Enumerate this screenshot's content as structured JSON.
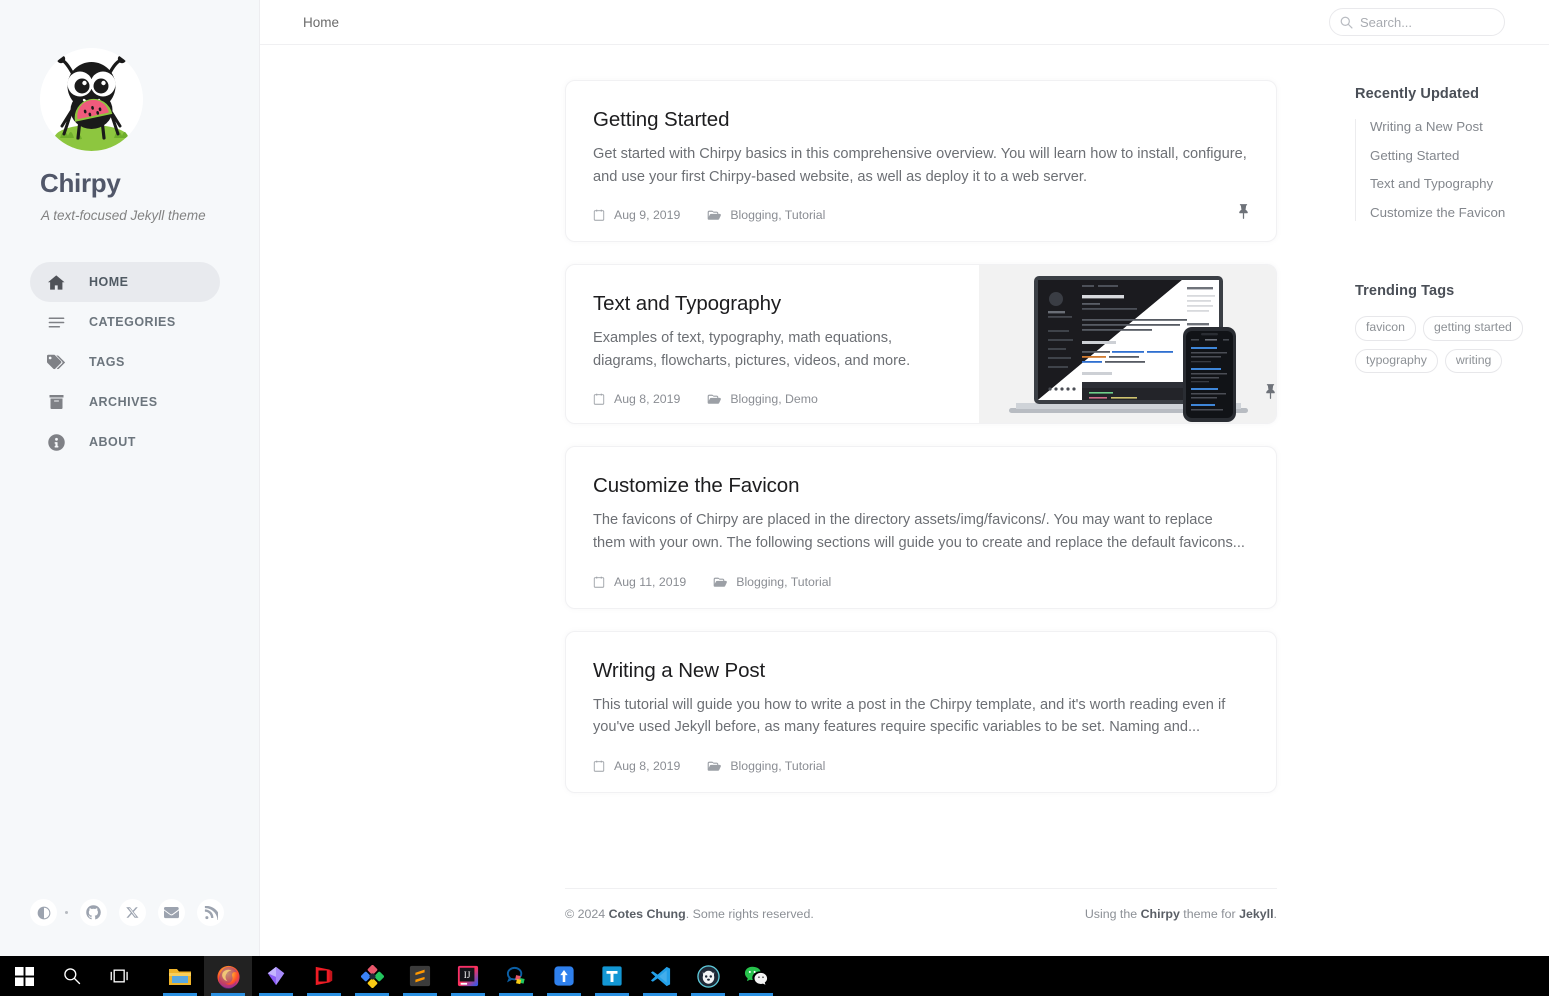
{
  "sidebar": {
    "avatar_icon": "chirpy-ant-avatar",
    "title": "Chirpy",
    "subtitle": "A text-focused Jekyll theme",
    "nav_items": [
      {
        "label": "HOME",
        "icon": "home-icon",
        "active": true
      },
      {
        "label": "CATEGORIES",
        "icon": "stream-list-icon",
        "active": false
      },
      {
        "label": "TAGS",
        "icon": "tags-icon",
        "active": false
      },
      {
        "label": "ARCHIVES",
        "icon": "archive-box-icon",
        "active": false
      },
      {
        "label": "ABOUT",
        "icon": "info-circle-icon",
        "active": false
      }
    ],
    "contact_icons": [
      "theme-toggle-icon",
      "github-icon",
      "x-twitter-icon",
      "email-icon",
      "rss-icon"
    ]
  },
  "topbar": {
    "breadcrumb": "Home",
    "search_placeholder": "Search...",
    "search_value": "",
    "search_icon": "search-icon"
  },
  "posts": [
    {
      "title": "Getting Started",
      "excerpt": "Get started with Chirpy basics in this comprehensive overview. You will learn how to install, configure, and use your first Chirpy-based website, as well as deploy it to a web server.",
      "date": "Aug 9, 2019",
      "categories": "Blogging, Tutorial",
      "pinned": true,
      "has_thumbnail": false
    },
    {
      "title": "Text and Typography",
      "excerpt": "Examples of text, typography, math equations, diagrams, flowcharts, pictures, videos, and more.",
      "date": "Aug 8, 2019",
      "categories": "Blogging, Demo",
      "pinned": true,
      "has_thumbnail": true,
      "thumbnail_alt": "laptop-and-phone-chirpy-theme-mockup"
    },
    {
      "title": "Customize the Favicon",
      "excerpt": "The favicons of Chirpy are placed in the directory assets/img/favicons/. You may want to replace them with your own. The following sections will guide you to create and replace the default favicons...",
      "date": "Aug 11, 2019",
      "categories": "Blogging, Tutorial",
      "pinned": false,
      "has_thumbnail": false
    },
    {
      "title": "Writing a New Post",
      "excerpt": "This tutorial will guide you how to write a post in the Chirpy template, and it's worth reading even if you've used Jekyll before, as many features require specific variables to be set. Naming and...",
      "date": "Aug 8, 2019",
      "categories": "Blogging, Tutorial",
      "pinned": false,
      "has_thumbnail": false
    }
  ],
  "right_panel": {
    "recently_updated": {
      "heading": "Recently Updated",
      "items": [
        "Writing a New Post",
        "Getting Started",
        "Text and Typography",
        "Customize the Favicon"
      ]
    },
    "trending_tags": {
      "heading": "Trending Tags",
      "tags": [
        "favicon",
        "getting started",
        "typography",
        "writing"
      ]
    }
  },
  "footer": {
    "copyright_prefix": "© 2024 ",
    "copyright_author": "Cotes Chung",
    "copyright_suffix": ". Some rights reserved.",
    "theme_prefix": "Using the ",
    "theme_name": "Chirpy",
    "theme_middle": " theme for ",
    "theme_platform": "Jekyll",
    "theme_suffix": "."
  },
  "taskbar": {
    "items": [
      {
        "name": "start-button",
        "icon": "windows-logo-icon",
        "running": false,
        "active": false
      },
      {
        "name": "search-button",
        "icon": "magnifier-icon",
        "running": false,
        "active": false
      },
      {
        "name": "task-view-button",
        "icon": "task-view-icon",
        "running": false,
        "active": false
      },
      {
        "name": "file-explorer",
        "icon": "folder-icon",
        "running": true,
        "active": false
      },
      {
        "name": "firefox",
        "icon": "firefox-icon",
        "running": true,
        "active": true
      },
      {
        "name": "gem-app",
        "icon": "purple-gem-icon",
        "running": true,
        "active": false
      },
      {
        "name": "red-app",
        "icon": "red-cube-icon",
        "running": true,
        "active": false
      },
      {
        "name": "diamond-app",
        "icon": "color-diamond-icon",
        "running": true,
        "active": false
      },
      {
        "name": "sublime-text",
        "icon": "sublime-text-icon",
        "running": true,
        "active": false
      },
      {
        "name": "intellij-idea",
        "icon": "intellij-idea-icon",
        "running": true,
        "active": false
      },
      {
        "name": "qq-chat",
        "icon": "qq-chat-icon",
        "running": true,
        "active": false
      },
      {
        "name": "blue-arrow-app",
        "icon": "blue-arrow-icon",
        "running": true,
        "active": false
      },
      {
        "name": "typora",
        "icon": "typora-t-icon",
        "running": true,
        "active": false
      },
      {
        "name": "vs-code",
        "icon": "vscode-icon",
        "running": true,
        "active": false
      },
      {
        "name": "husky-app",
        "icon": "husky-circle-icon",
        "running": true,
        "active": false
      },
      {
        "name": "wechat",
        "icon": "wechat-icon",
        "running": true,
        "active": false
      }
    ]
  },
  "colors": {
    "sidebar_bg": "#f6f8fa",
    "page_bg": "#ffffff",
    "active_nav_bg": "#e8eaee",
    "title_color": "#515769",
    "taskbar_bg": "#000000",
    "taskbar_accent": "#2a8fe0"
  }
}
